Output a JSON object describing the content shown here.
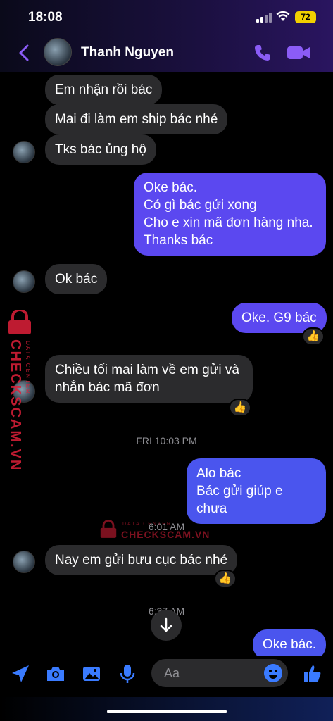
{
  "status_bar": {
    "time": "18:08",
    "battery": "72"
  },
  "header": {
    "contact_name": "Thanh Nguyen"
  },
  "messages": [
    {
      "side": "in",
      "lines": [
        "Em nhận rồi bác"
      ]
    },
    {
      "side": "in",
      "lines": [
        "Mai đi làm em ship bác nhé"
      ]
    },
    {
      "side": "in",
      "lines": [
        "Tks bác ủng hộ"
      ]
    },
    {
      "side": "out",
      "lines": [
        "Oke bác.",
        "Có gì bác gửi xong",
        "Cho e xin mã đơn hàng nha.",
        "Thanks bác"
      ]
    },
    {
      "side": "in",
      "lines": [
        "Ok bác"
      ]
    },
    {
      "side": "out",
      "lines": [
        "Oke. G9 bác"
      ],
      "reaction": "👍"
    },
    {
      "side": "in",
      "lines": [
        "Chiều tối mai làm về em gửi và",
        "nhắn bác mã đơn"
      ],
      "reaction": "👍"
    },
    {
      "side": "out",
      "lines": [
        "Alo bác",
        "Bác gửi giúp e chưa"
      ]
    },
    {
      "side": "in",
      "lines": [
        "Nay em gửi bưu cục bác nhé"
      ],
      "reaction": "👍"
    },
    {
      "side": "out",
      "lines": [
        "Oke bác."
      ]
    }
  ],
  "timestamps": [
    "FRI 10:03 PM",
    "6:01 AM",
    "6:37 AM"
  ],
  "watermark": {
    "brand": "CHECKSCAM.VN",
    "tagline": "DATA CENTER"
  },
  "composer": {
    "placeholder": "Aa"
  },
  "colors": {
    "accent": "#7c5cff",
    "outgoing": "#5b48f0",
    "incoming": "#2b2b2d",
    "watermark": "#e0203a"
  },
  "icons": [
    "back-chevron-icon",
    "phone-icon",
    "video-camera-icon",
    "location-arrow-icon",
    "camera-icon",
    "image-icon",
    "microphone-icon",
    "emoji-icon",
    "thumbs-up-icon",
    "arrow-down-icon"
  ]
}
